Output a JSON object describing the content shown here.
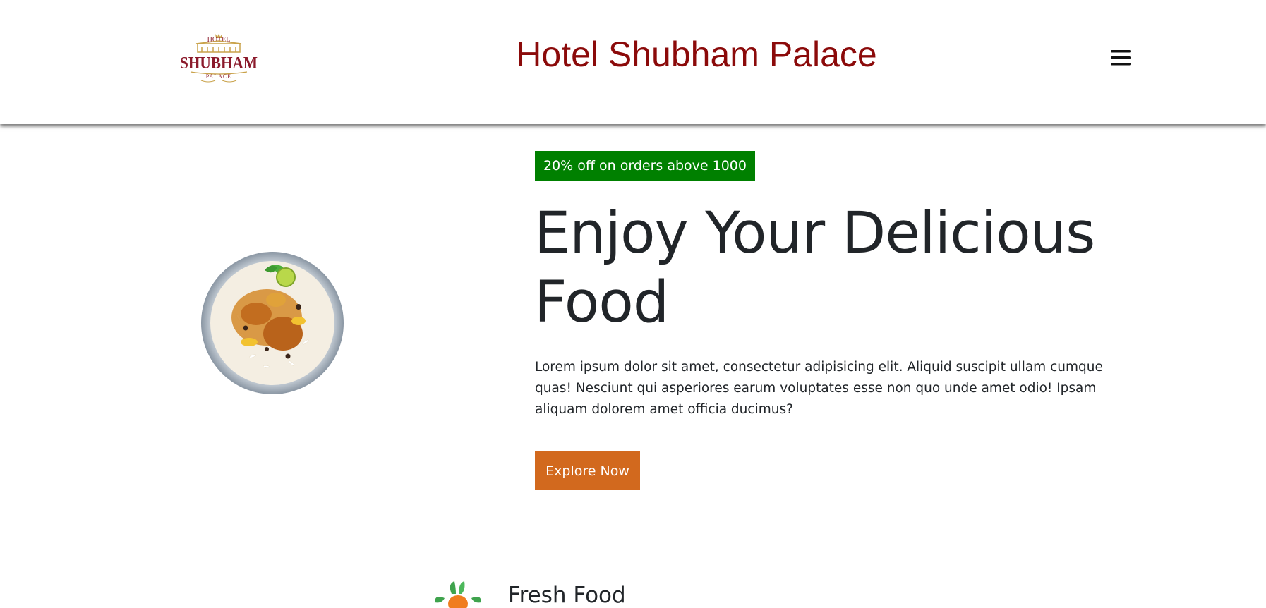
{
  "header": {
    "logo_text": {
      "top": "HOTEL",
      "main": "SHUBHAM",
      "bottom": "PALACE"
    },
    "title": "Hotel Shubham Palace",
    "menu_icon": "hamburger-menu-icon"
  },
  "hero": {
    "offer_badge": "20% off on orders above 1000",
    "heading": "Enjoy Your Delicious Food",
    "description": "Lorem ipsum dolor sit amet, consectetur adipisicing elit. Aliquid suscipit ullam cumque quas! Nesciunt qui asperiores earum voluptates esse non quo unde amet odio! Ipsam aliquam dolorem amet officia ducimus?",
    "button_label": "Explore Now",
    "image": "biryani-plate-image"
  },
  "features": [
    {
      "title": "Fresh Food",
      "icon": "vegetable-icon"
    }
  ],
  "colors": {
    "title": "#8b0a0a",
    "badge": "#008000",
    "button": "#d2691e",
    "text": "#212529"
  }
}
